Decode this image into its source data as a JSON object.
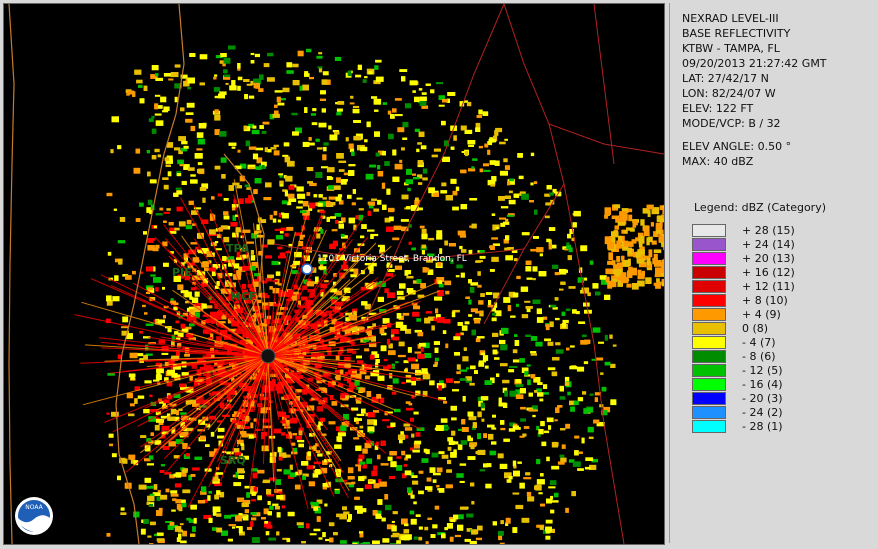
{
  "map": {
    "cities": [
      {
        "code": "TPA"
      },
      {
        "code": "PIE"
      },
      {
        "code": "MCF"
      },
      {
        "code": "SRQ"
      }
    ],
    "marker_label": "1101 Victoria Street, Brandon, FL",
    "logo_text": "NOAA"
  },
  "info": {
    "product": "NEXRAD LEVEL-III",
    "type": "BASE REFLECTIVITY",
    "station": "KTBW - TAMPA, FL",
    "datetime": "09/20/2013 21:27:42 GMT",
    "lat": "LAT: 27/42/17 N",
    "lon": "LON: 82/24/07 W",
    "elev": "ELEV: 122 FT",
    "mode": "MODE/VCP: B / 32",
    "elev_angle": "ELEV ANGLE: 0.50 °",
    "max": "MAX: 40 dBZ"
  },
  "legend": {
    "title": "Legend: dBZ (Category)",
    "items": [
      {
        "label": "+ 28  (15)",
        "color": "#e8e8e8"
      },
      {
        "label": "+ 24  (14)",
        "color": "#9955cc"
      },
      {
        "label": "+ 20  (13)",
        "color": "#ff00ff"
      },
      {
        "label": "+ 16  (12)",
        "color": "#c80000"
      },
      {
        "label": "+ 12  (11)",
        "color": "#e00000"
      },
      {
        "label": "+ 8  (10)",
        "color": "#ff0000"
      },
      {
        "label": "+ 4  (9)",
        "color": "#ff9900"
      },
      {
        "label": "0  (8)",
        "color": "#e8c000"
      },
      {
        "label": "- 4  (7)",
        "color": "#ffff00"
      },
      {
        "label": "- 8  (6)",
        "color": "#008c00"
      },
      {
        "label": "- 12  (5)",
        "color": "#00c000"
      },
      {
        "label": "- 16  (4)",
        "color": "#00ff00"
      },
      {
        "label": "- 20  (3)",
        "color": "#0000ff"
      },
      {
        "label": "- 24  (2)",
        "color": "#1e90ff"
      },
      {
        "label": "- 28  (1)",
        "color": "#00ffff"
      }
    ]
  }
}
